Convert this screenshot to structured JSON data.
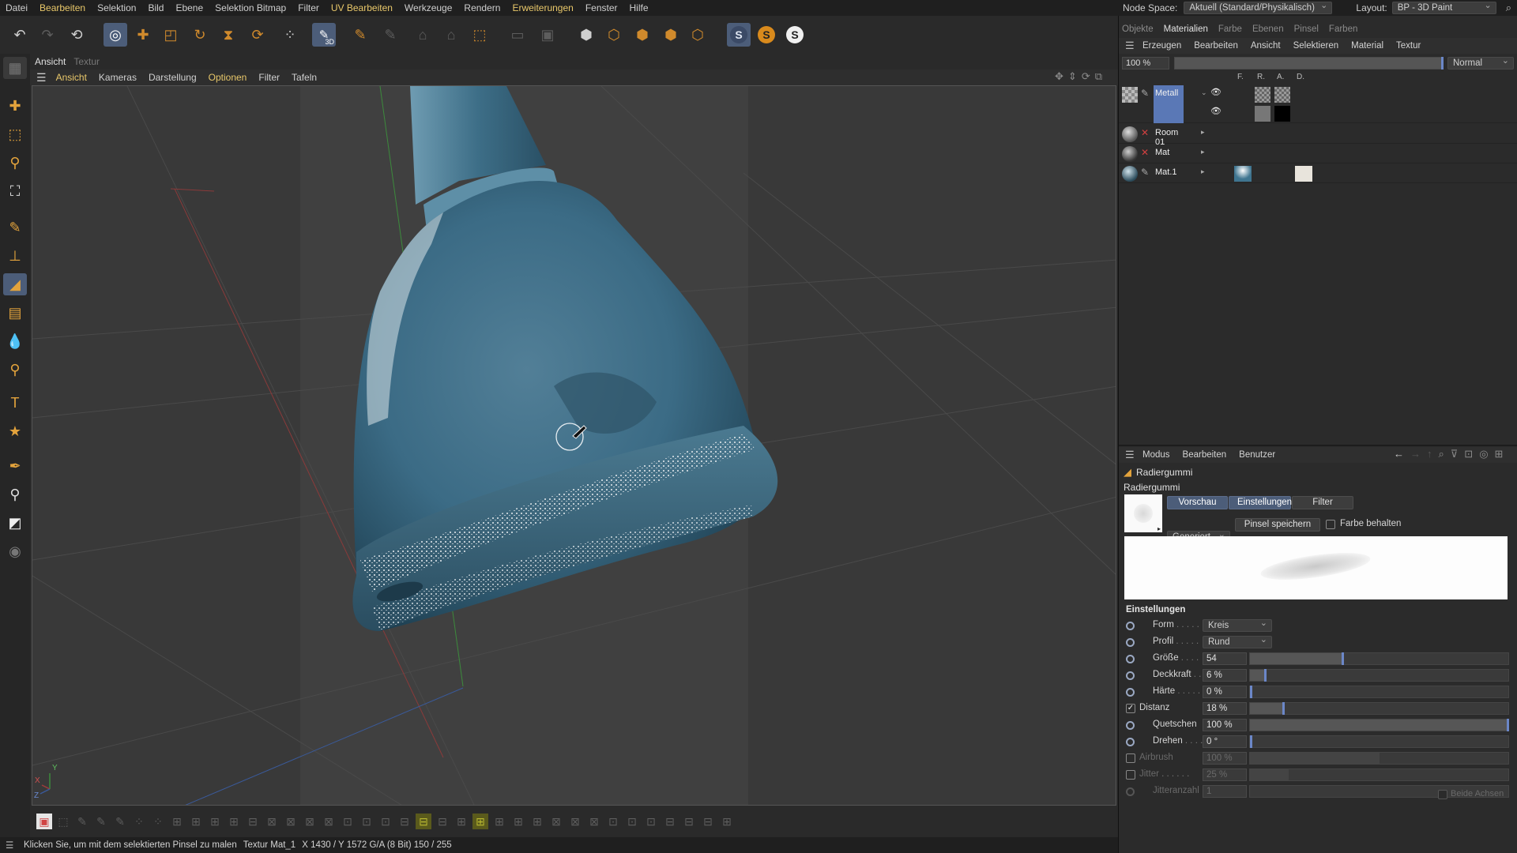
{
  "menubar": {
    "items": [
      "Datei",
      "Bearbeiten",
      "Selektion",
      "Bild",
      "Ebene",
      "Selektion Bitmap",
      "Filter",
      "UV Bearbeiten",
      "Werkzeuge",
      "Rendern",
      "Erweiterungen",
      "Fenster",
      "Hilfe"
    ],
    "highlighted": [
      "Bearbeiten",
      "UV Bearbeiten",
      "Erweiterungen"
    ]
  },
  "nodespace": {
    "label": "Node Space:",
    "value": "Aktuell (Standard/Physikalisch)",
    "layout_label": "Layout:",
    "layout_value": "BP - 3D Paint"
  },
  "toolbar": {
    "icons": [
      "undo-icon",
      "redo-icon",
      "reload-icon",
      "live-selection-icon",
      "move-icon",
      "scale-icon",
      "rotate-icon",
      "snap-icon",
      "rotate-tool-icon",
      "uv-points-icon",
      "paint-3d-icon",
      "brush-projection-icon",
      "brush-alt-icon",
      "camera-icon",
      "projection-alt-icon",
      "render-icon",
      "blank-icon",
      "layer-icon",
      "cube-checker-icon",
      "cube-icon",
      "cube-shaded-icon",
      "cube-grey-icon",
      "cube-dim-icon",
      "s-icon-blue",
      "s-icon-orange",
      "s-icon-white"
    ],
    "paint_3d_label": "3D"
  },
  "viewport": {
    "tabs": [
      "Ansicht",
      "Textur"
    ],
    "active_tab": "Ansicht",
    "menu": [
      "Ansicht",
      "Kameras",
      "Darstellung",
      "Optionen",
      "Filter",
      "Tafeln"
    ],
    "menu_highlighted": [
      "Ansicht",
      "Optionen"
    ],
    "axis_labels": {
      "x": "X",
      "y": "Y",
      "z": "Z"
    }
  },
  "status": {
    "message": "Klicken Sie, um mit dem selektierten Pinsel zu malen",
    "texture": "Textur Mat_1",
    "coords": "X 1430 / Y 1572 G/A (8 Bit) 150 / 255"
  },
  "right": {
    "top_tabs": [
      "Objekte",
      "Materialien",
      "Farbe",
      "Ebenen",
      "Pinsel",
      "Farben"
    ],
    "top_active": "Materialien",
    "mat_menu": [
      "Erzeugen",
      "Bearbeiten",
      "Ansicht",
      "Selektieren",
      "Material",
      "Textur"
    ],
    "zoom": "100 %",
    "blend": "Normal",
    "channel_headers": [
      "F.",
      "R.",
      "A.",
      "D."
    ],
    "materials": [
      {
        "name": "Metall",
        "selected": true
      },
      {
        "name": "Room 01",
        "selected": false
      },
      {
        "name": "Mat",
        "selected": false
      },
      {
        "name": "Mat.1",
        "selected": false
      }
    ],
    "attr_menu": [
      "Modus",
      "Bearbeiten",
      "Benutzer"
    ],
    "tool_title": "Radiergummi",
    "section_title": "Radiergummi",
    "brush_tabs": [
      "Vorschau",
      "Einstellungen",
      "Filter"
    ],
    "brush_tabs_active": [
      "Vorschau",
      "Einstellungen"
    ],
    "preset_combo": "Generiert",
    "save_button": "Pinsel speichern",
    "keep_color": "Farbe behalten",
    "settings_title": "Einstellungen",
    "params": [
      {
        "label": "Form",
        "dots": " . . . . .",
        "kind": "combo",
        "value": "Kreis",
        "enabled": true
      },
      {
        "label": "Profil",
        "dots": " . . . . .",
        "kind": "combo",
        "value": "Rund",
        "enabled": true
      },
      {
        "label": "Größe",
        "dots": " . . . .",
        "kind": "slider",
        "value": "54",
        "fill": 0.36,
        "enabled": true
      },
      {
        "label": "Deckkraft",
        "dots": " . .",
        "kind": "slider",
        "value": "6 %",
        "fill": 0.06,
        "enabled": true
      },
      {
        "label": "Härte",
        "dots": " . . . . .",
        "kind": "slider",
        "value": "0 %",
        "fill": 0.0,
        "enabled": true
      },
      {
        "label": "Distanz",
        "dots": "",
        "kind": "slider",
        "value": "18 %",
        "fill": 0.13,
        "enabled": true,
        "check": true
      },
      {
        "label": "Quetschen",
        "dots": "",
        "kind": "slider",
        "value": "100 %",
        "fill": 1.0,
        "enabled": true
      },
      {
        "label": "Drehen",
        "dots": " . . . . .",
        "kind": "slider",
        "value": "0 °",
        "fill": 0.0,
        "enabled": true
      },
      {
        "label": "Airbrush",
        "dots": "",
        "kind": "slider",
        "value": "100 %",
        "fill": 0.5,
        "enabled": false,
        "check": false
      },
      {
        "label": "Jitter",
        "dots": " . . . . . .",
        "kind": "slider",
        "value": "25 %",
        "fill": 0.15,
        "enabled": false,
        "check": false
      },
      {
        "label": "Jitteranzahl",
        "dots": "",
        "kind": "slider",
        "value": "1",
        "fill": 0.0,
        "enabled": false
      }
    ],
    "both_axes": "Beide Achsen"
  },
  "colors": {
    "accent": "#4c5d79",
    "menu_highlight": "#e9c86a",
    "tool_orange": "#e3a33c",
    "object_blue": "#3e6d86"
  }
}
